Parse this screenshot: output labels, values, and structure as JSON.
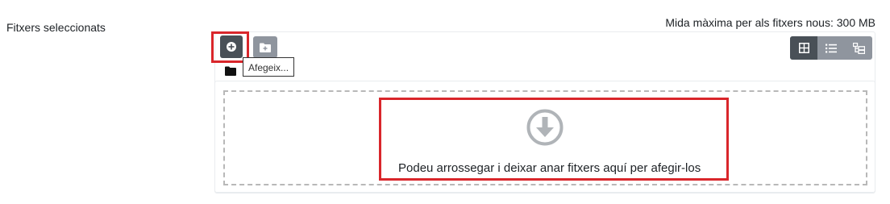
{
  "field": {
    "label": "Fitxers seleccionats"
  },
  "filemanager": {
    "max_size_text": "Mida màxima per als fitxers nous: 300 MB",
    "toolbar": {
      "add_icon": "plus-circle-icon",
      "folder_icon": "new-folder-icon",
      "add_tooltip": "Afegeix..."
    },
    "path": {
      "icon": "folder-icon"
    },
    "views": [
      {
        "name": "icons",
        "icon": "grid-icon",
        "active": true
      },
      {
        "name": "list",
        "icon": "list-icon",
        "active": false
      },
      {
        "name": "tree",
        "icon": "tree-icon",
        "active": false
      }
    ],
    "dropzone": {
      "icon": "download-arrow-icon",
      "text": "Podeu arrossegar i deixar anar fitxers aquí per afegir-los"
    }
  },
  "colors": {
    "highlight": "#d9262b",
    "button_dark": "#495057",
    "button_light": "#8f959e",
    "dashed_border": "#b8b8b8",
    "drop_icon": "#b0b4b8"
  }
}
